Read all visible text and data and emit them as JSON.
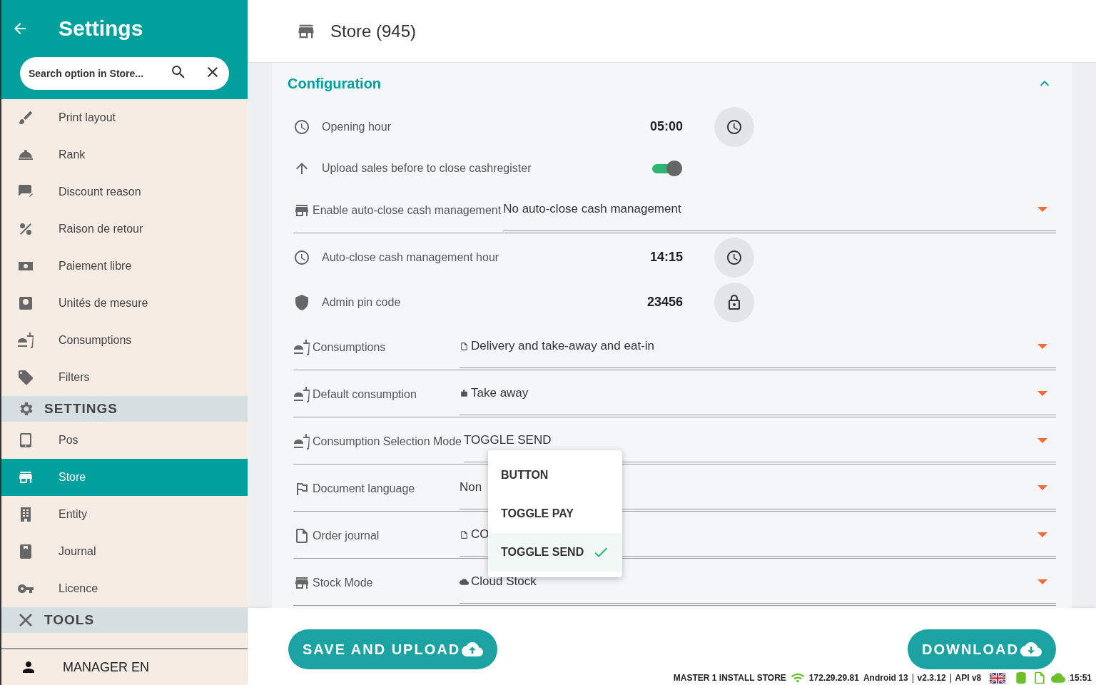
{
  "sidebar": {
    "title": "Settings",
    "search": {
      "placeholder": "Search option in Store..."
    },
    "items": [
      {
        "kind": "item",
        "label": "Print layout",
        "selected": false
      },
      {
        "kind": "item",
        "label": "Rank",
        "selected": false
      },
      {
        "kind": "item",
        "label": "Discount reason",
        "selected": false
      },
      {
        "kind": "item",
        "label": "Raison de retour",
        "selected": false
      },
      {
        "kind": "item",
        "label": "Paiement libre",
        "selected": false
      },
      {
        "kind": "item",
        "label": "Unités de mesure",
        "selected": false
      },
      {
        "kind": "item",
        "label": "Consumptions",
        "selected": false
      },
      {
        "kind": "item",
        "label": "Filters",
        "selected": false
      },
      {
        "kind": "section",
        "label": "SETTINGS"
      },
      {
        "kind": "item",
        "label": "Pos",
        "selected": false
      },
      {
        "kind": "item",
        "label": "Store",
        "selected": true
      },
      {
        "kind": "item",
        "label": "Entity",
        "selected": false
      },
      {
        "kind": "item",
        "label": "Journal",
        "selected": false
      },
      {
        "kind": "item",
        "label": "Licence",
        "selected": false
      },
      {
        "kind": "section",
        "label": "TOOLS"
      }
    ],
    "user": "MANAGER EN"
  },
  "page": {
    "title": "Store (945)"
  },
  "card": {
    "title": "Configuration",
    "expanded": true,
    "rows": [
      {
        "kind": "time",
        "label": "Opening hour",
        "value": "05:00"
      },
      {
        "kind": "toggle",
        "label": "Upload sales before to close cashregister",
        "on": true
      },
      {
        "kind": "select",
        "label": "Enable auto-close cash management",
        "value": "No auto-close cash management"
      },
      {
        "kind": "time",
        "label": "Auto-close cash management hour",
        "value": "14:15"
      },
      {
        "kind": "pin",
        "label": "Admin pin code",
        "value": "23456"
      },
      {
        "kind": "select",
        "label": "Consumptions",
        "value": "Delivery and take-away and eat-in"
      },
      {
        "kind": "select",
        "label": "Default consumption",
        "value": "Take away"
      },
      {
        "kind": "select",
        "label": "Consumption Selection Mode",
        "value": "TOGGLE SEND",
        "dropdown": [
          {
            "label": "BUTTON",
            "selected": false
          },
          {
            "label": "TOGGLE PAY",
            "selected": false
          },
          {
            "label": "TOGGLE SEND",
            "selected": true
          }
        ]
      },
      {
        "kind": "select",
        "label": "Document language",
        "value": "Non"
      },
      {
        "kind": "select",
        "label": "Order journal",
        "value": "CO"
      },
      {
        "kind": "select",
        "label": "Stock Mode",
        "value": "Cloud Stock"
      }
    ]
  },
  "buttons": {
    "save": "SAVE AND UPLOAD",
    "download": "DOWNLOAD"
  },
  "status_bar": {
    "store": "MASTER 1 INSTALL STORE",
    "ip": "172.29.29.81",
    "os": "Android 13",
    "version": "v2.3.12",
    "api": "API v8",
    "time": "15:51"
  }
}
